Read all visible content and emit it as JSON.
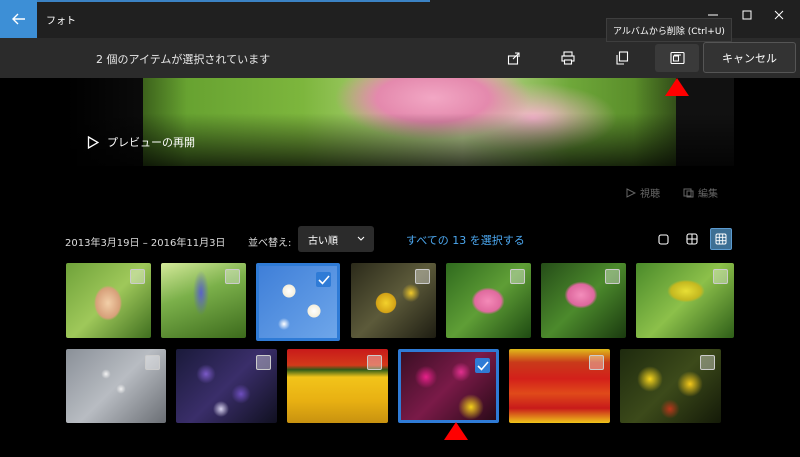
{
  "app": {
    "title": "フォト",
    "back_icon": "back-arrow-icon"
  },
  "toolbar": {
    "selection_text": "2 個のアイテムが選択されています",
    "cancel_label": "キャンセル",
    "tooltip": "アルバムから削除 (Ctrl+U)",
    "buttons": [
      "share-icon",
      "print-icon",
      "copy-icon",
      "remove-from-album-icon"
    ]
  },
  "preview": {
    "play_label": "プレビューの再開"
  },
  "mini_actions": {
    "watch_label": "視聴",
    "edit_label": "編集"
  },
  "filter": {
    "date_range": "2013年3月19日 – 2016年11月3日",
    "sort_label": "並べ替え:",
    "sort_value": "古い順",
    "select_all": "すべての 13 を選択する"
  },
  "colors": {
    "accent": "#3d8fd6",
    "selection": "#2f7bd6",
    "link": "#4ca8f0",
    "annotation_arrow": "#ff0000"
  },
  "photos_row1": [
    {
      "subject": "camellia bud",
      "selected": false
    },
    {
      "subject": "hyacinth buds",
      "selected": false
    },
    {
      "subject": "white plum blossoms",
      "selected": true
    },
    {
      "subject": "yellow flowers",
      "selected": false
    },
    {
      "subject": "pink azalea",
      "selected": false
    },
    {
      "subject": "pink azalea 2",
      "selected": false
    },
    {
      "subject": "rapeseed flowers",
      "selected": false
    }
  ],
  "photos_row2": [
    {
      "subject": "white blossoms",
      "selected": false
    },
    {
      "subject": "purple petunias",
      "selected": false
    },
    {
      "subject": "yellow marigold field",
      "selected": false
    },
    {
      "subject": "pink petunias and marigolds",
      "selected": true
    },
    {
      "subject": "red and yellow flowerbed",
      "selected": false
    },
    {
      "subject": "yellow marigolds",
      "selected": false
    }
  ]
}
